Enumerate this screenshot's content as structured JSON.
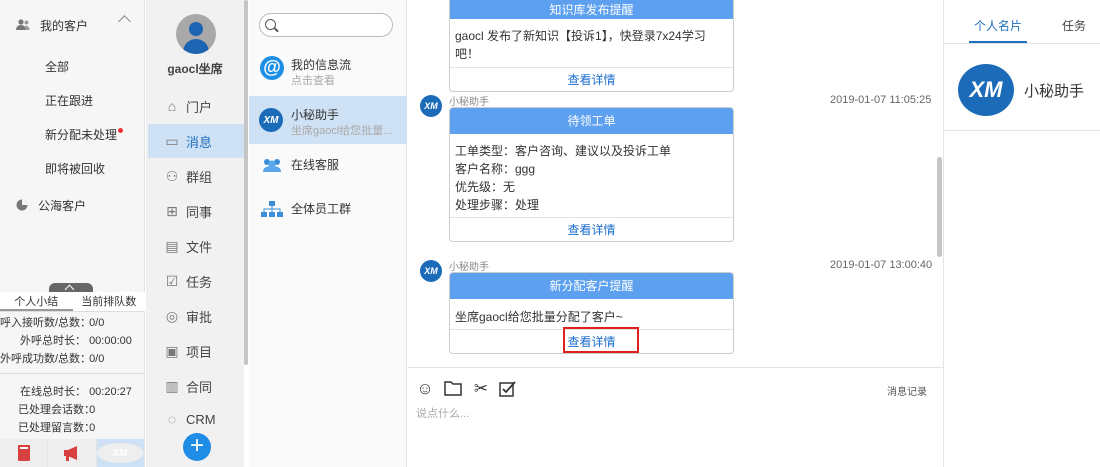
{
  "sidebar": {
    "my_customers": "我的客户",
    "sub_items": [
      {
        "label": "全部"
      },
      {
        "label": "正在跟进"
      },
      {
        "label": "新分配未处理"
      },
      {
        "label": "即将被回收"
      }
    ],
    "sea_customers": "公海客户"
  },
  "stats": {
    "tabs": [
      "个人小结",
      "当前排队数"
    ],
    "rows": [
      {
        "label": "呼入接听数/总数：",
        "value": "0/0"
      },
      {
        "label": "外呼总时长：",
        "value": "00:00:00"
      },
      {
        "label": "外呼成功数/总数：",
        "value": "0/0"
      },
      {
        "label": "在线总时长：",
        "value": "00:20:27"
      },
      {
        "label": "已处理会话数：",
        "value": "0"
      },
      {
        "label": "已处理留言数：",
        "value": "0"
      }
    ]
  },
  "user": {
    "name": "gaocl坐席"
  },
  "nav": [
    {
      "label": "门户",
      "icon": "home-icon"
    },
    {
      "label": "消息",
      "icon": "message-icon"
    },
    {
      "label": "群组",
      "icon": "group-icon"
    },
    {
      "label": "同事",
      "icon": "org-icon"
    },
    {
      "label": "文件",
      "icon": "file-icon"
    },
    {
      "label": "任务",
      "icon": "task-icon"
    },
    {
      "label": "审批",
      "icon": "approval-icon"
    },
    {
      "label": "项目",
      "icon": "project-icon"
    },
    {
      "label": "合同",
      "icon": "contract-icon"
    },
    {
      "label": "CRM",
      "icon": "crm-icon"
    }
  ],
  "conversations": [
    {
      "title": "我的信息流",
      "subtitle": "点击查看"
    },
    {
      "title": "小秘助手",
      "subtitle": "坐席gaocl给您批量..."
    },
    {
      "title": "在线客服",
      "subtitle": ""
    },
    {
      "title": "全体员工群",
      "subtitle": ""
    }
  ],
  "chat": {
    "messages": [
      {
        "header": "知识库发布提醒",
        "lines": [
          "gaocl 发布了新知识【投诉1】，快登录7x24学习吧！"
        ],
        "link": "查看详情"
      },
      {
        "sender": "小秘助手",
        "time": "2019-01-07 11:05:25",
        "header": "待领工单",
        "lines": [
          "工单类型：客户咨询、建议以及投诉工单",
          "客户名称：ggg",
          "优先级：无",
          "处理步骤：处理"
        ],
        "link": "查看详情"
      },
      {
        "sender": "小秘助手",
        "time": "2019-01-07 13:00:40",
        "header": "新分配客户提醒",
        "lines": [
          "坐席gaocl给您批量分配了客户~"
        ],
        "link": "查看详情"
      }
    ],
    "history_label": "消息记录",
    "input_placeholder": "说点什么..."
  },
  "right_panel": {
    "tabs": [
      "个人名片",
      "任务"
    ],
    "card_name": "小秘助手",
    "logo_text": "XM"
  },
  "colors": {
    "accent": "#1e6fbf",
    "card_header": "#5da0f0",
    "highlight": "#e02020"
  }
}
